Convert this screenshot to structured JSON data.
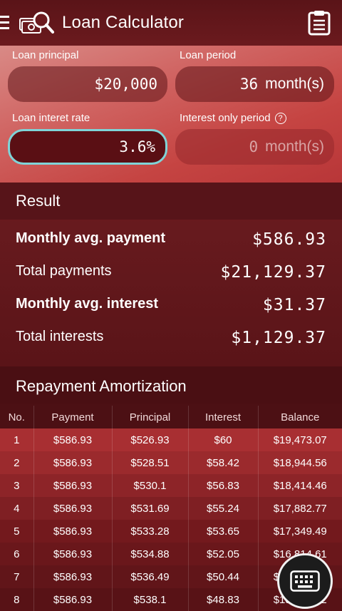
{
  "app": {
    "title": "Loan Calculator"
  },
  "icons": {
    "menu": "menu-icon",
    "logo": "loan-search-icon",
    "history": "clipboard-icon",
    "keyboard": "keyboard-icon",
    "help": "help-icon"
  },
  "inputs": {
    "principal": {
      "label": "Loan principal",
      "value": "$20,000"
    },
    "period": {
      "label": "Loan period",
      "value": "36",
      "unit": "month(s)"
    },
    "rate": {
      "label": "Loan interet rate",
      "value": "3.6%"
    },
    "interest_only": {
      "label": "Interest only period",
      "value": "0",
      "unit": "month(s)"
    }
  },
  "result": {
    "title": "Result",
    "rows": [
      {
        "label": "Monthly avg. payment",
        "value": "$586.93"
      },
      {
        "label": "Total payments",
        "value": "$21,129.37"
      },
      {
        "label": "Monthly avg. interest",
        "value": "$31.37"
      },
      {
        "label": "Total interests",
        "value": "$1,129.37"
      }
    ]
  },
  "amortization": {
    "title": "Repayment Amortization",
    "headers": [
      "No.",
      "Payment",
      "Principal",
      "Interest",
      "Balance"
    ],
    "rows": [
      [
        "1",
        "$586.93",
        "$526.93",
        "$60",
        "$19,473.07"
      ],
      [
        "2",
        "$586.93",
        "$528.51",
        "$58.42",
        "$18,944.56"
      ],
      [
        "3",
        "$586.93",
        "$530.1",
        "$56.83",
        "$18,414.46"
      ],
      [
        "4",
        "$586.93",
        "$531.69",
        "$55.24",
        "$17,882.77"
      ],
      [
        "5",
        "$586.93",
        "$533.28",
        "$53.65",
        "$17,349.49"
      ],
      [
        "6",
        "$586.93",
        "$534.88",
        "$52.05",
        "$16,814.61"
      ],
      [
        "7",
        "$586.93",
        "$536.49",
        "$50.44",
        "$16,278.12"
      ],
      [
        "8",
        "$586.93",
        "$538.1",
        "$48.83",
        "$15,740.02"
      ]
    ]
  },
  "colors": {
    "accent": "#7fd4d8",
    "header_bg": "#5a1418",
    "input_panel": "#c54442"
  }
}
